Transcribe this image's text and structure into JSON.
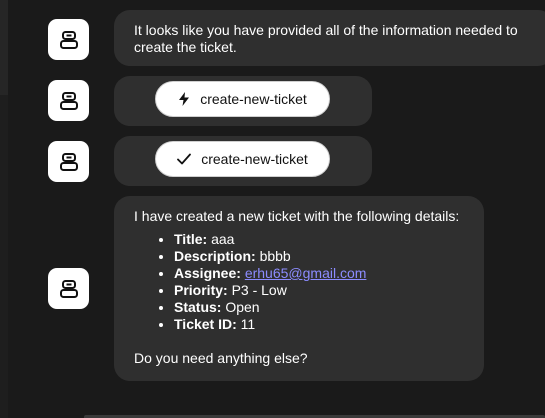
{
  "messages": {
    "m1": {
      "text": "It looks like you have provided all of the information needed to create the ticket."
    },
    "m2": {
      "tool_label": "create-new-ticket",
      "icon": "lightning-icon"
    },
    "m3": {
      "tool_label": "create-new-ticket",
      "icon": "check-icon"
    },
    "m4": {
      "intro": "I have created a new ticket with the following details:",
      "details": [
        {
          "key": "Title:",
          "value": "aaa"
        },
        {
          "key": "Description:",
          "value": "bbbb"
        },
        {
          "key": "Assignee:",
          "value": "erhu65@gmail.com"
        },
        {
          "key": "Priority:",
          "value": "P3 - Low"
        },
        {
          "key": "Status:",
          "value": "Open"
        },
        {
          "key": "Ticket ID:",
          "value": "11"
        }
      ],
      "outro": "Do you need anything else?"
    }
  },
  "colors": {
    "background": "#1a1a1a",
    "bubble": "#2f2f2f",
    "link": "#8c8cff",
    "avatar": "#ffffff"
  }
}
